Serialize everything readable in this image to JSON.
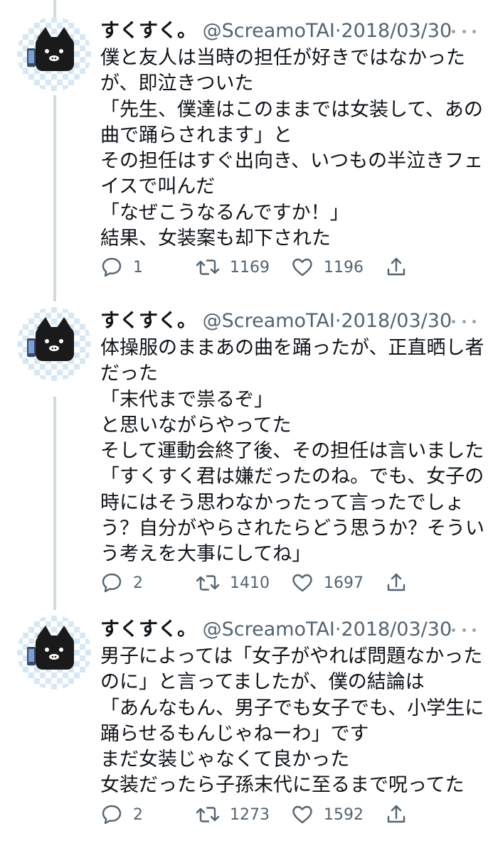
{
  "tweets": [
    {
      "name": "すくすく。",
      "handle": "@ScreamoTAI",
      "sep": "·",
      "date": "2018/03/30",
      "lines": [
        "僕と友人は当時の担任が好きではなかった",
        "が、即泣きついた",
        "「先生、僕達はこのままでは女装して、あの",
        "曲で踊らされます」と",
        "その担任はすぐ出向き、いつもの半泣きフェ",
        "イスで叫んだ",
        "「なぜこうなるんですか！」",
        "結果、女装案も却下された"
      ],
      "replies": "1",
      "retweets": "1169",
      "likes": "1196"
    },
    {
      "name": "すくすく。",
      "handle": "@ScreamoTAI",
      "sep": "·",
      "date": "2018/03/30",
      "lines": [
        "体操服のままあの曲を踊ったが、正直晒し者",
        "だった",
        "「末代まで祟るぞ」",
        "と思いながらやってた",
        "そして運動会終了後、その担任は言いました",
        "「すくすく君は嫌だったのね。でも、女子の",
        "時にはそう思わなかったって言ったでしょ",
        "う？自分がやらされたらどう思うか？そうい",
        "う考えを大事にしてね」"
      ],
      "replies": "2",
      "retweets": "1410",
      "likes": "1697"
    },
    {
      "name": "すくすく。",
      "handle": "@ScreamoTAI",
      "sep": "·",
      "date": "2018/03/30",
      "lines": [
        "男子によっては「女子がやれば問題なかった",
        "のに」と言ってましたが、僕の結論は",
        "「あんなもん、男子でも女子でも、小学生に",
        "踊らせるもんじゃねーわ」です",
        "まだ女装じゃなくて良かった",
        "女装だったら子孫末代に至るまで呪ってた"
      ],
      "replies": "2",
      "retweets": "1273",
      "likes": "1592"
    }
  ],
  "icons": {
    "reply": "speech-bubble",
    "retweet": "retweet-arrows",
    "like": "heart-outline",
    "share": "share-arrow-up",
    "more": "three-dots"
  },
  "colors": {
    "text": "#0f1419",
    "secondary": "#536471",
    "thread_line": "#cfd9de",
    "avatar_checker_a": "#d6e8f5",
    "avatar_checker_b": "#ffffff"
  }
}
